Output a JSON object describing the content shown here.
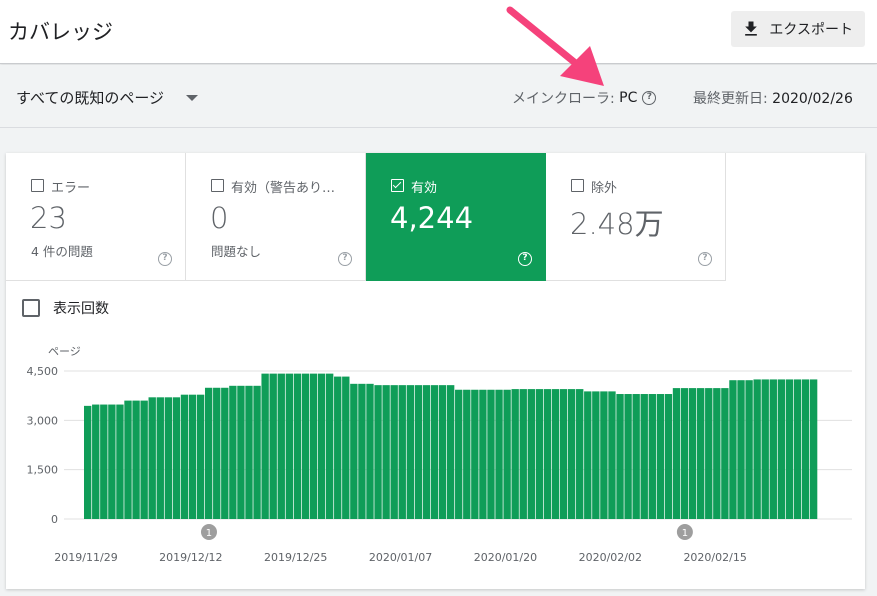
{
  "header": {
    "title": "カバレッジ",
    "export_label": "エクスポート"
  },
  "filter": {
    "selected": "すべての既知のページ",
    "crawler_label": "メインクローラ:",
    "crawler_value": "PC",
    "updated_label": "最終更新日:",
    "updated_value": "2020/02/26"
  },
  "tiles": [
    {
      "label": "エラー",
      "value": "23",
      "sub": "4 件の問題",
      "checked": false
    },
    {
      "label": "有効（警告あり…",
      "value": "0",
      "sub": "問題なし",
      "checked": false
    },
    {
      "label": "有効",
      "value": "4,244",
      "sub": "",
      "checked": true
    },
    {
      "label": "除外",
      "value": "2.48万",
      "sub": "",
      "checked": false
    }
  ],
  "impressions_label": "表示回数",
  "colors": {
    "accent": "#0f9d58",
    "annotation_arrow": "#f5427b"
  },
  "chart_data": {
    "type": "bar",
    "ylabel": "ページ",
    "ylim": [
      0,
      4500
    ],
    "yticks": [
      "4,500",
      "3,000",
      "1,500",
      "0"
    ],
    "xticks": [
      "2019/11/29",
      "2019/12/12",
      "2019/12/25",
      "2020/01/07",
      "2020/01/20",
      "2020/02/02",
      "2020/02/15"
    ],
    "annotations": [
      {
        "label": "1",
        "near": "2019/12/12"
      },
      {
        "label": "1",
        "near": "2020/02/15"
      }
    ],
    "values": [
      3440,
      3480,
      3480,
      3480,
      3480,
      3600,
      3600,
      3600,
      3700,
      3700,
      3700,
      3700,
      3780,
      3780,
      3780,
      3990,
      3990,
      3990,
      4050,
      4050,
      4050,
      4050,
      4420,
      4420,
      4420,
      4420,
      4420,
      4420,
      4420,
      4420,
      4420,
      4330,
      4330,
      4110,
      4110,
      4110,
      4070,
      4070,
      4070,
      4070,
      4070,
      4070,
      4070,
      4070,
      4070,
      4070,
      3930,
      3930,
      3930,
      3930,
      3930,
      3930,
      3930,
      3950,
      3950,
      3950,
      3950,
      3950,
      3950,
      3950,
      3950,
      3950,
      3880,
      3880,
      3880,
      3880,
      3800,
      3800,
      3800,
      3800,
      3800,
      3800,
      3800,
      3980,
      3980,
      3980,
      3980,
      3980,
      3980,
      3980,
      4220,
      4220,
      4220,
      4244,
      4244,
      4244,
      4244,
      4244,
      4244,
      4244,
      4244
    ]
  }
}
